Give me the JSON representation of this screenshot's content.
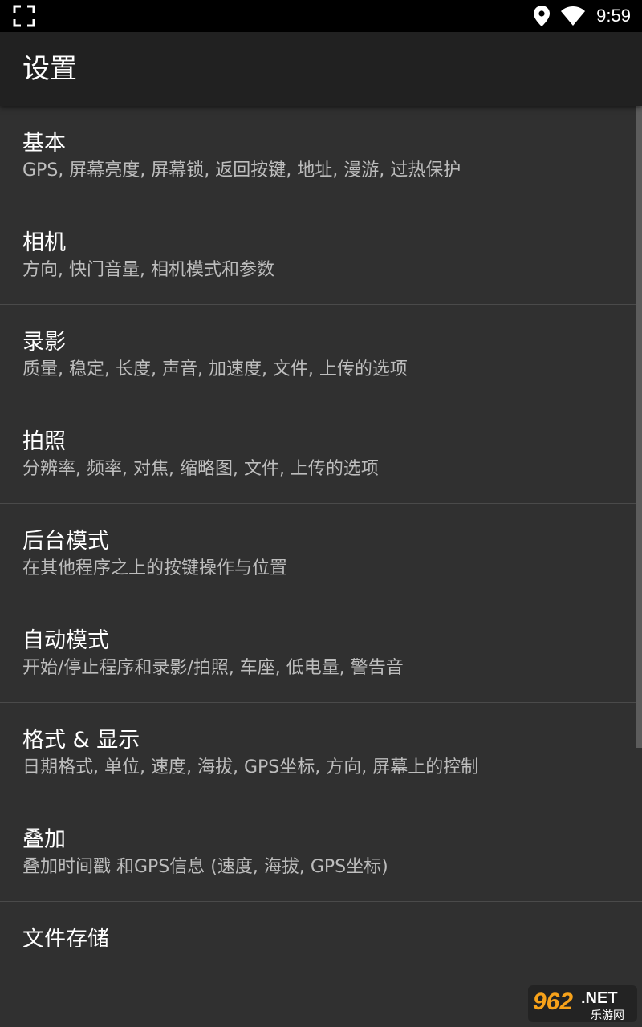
{
  "status_bar": {
    "time": "9:59",
    "icons": [
      "fullscreen-icon",
      "location-icon",
      "wifi-icon"
    ]
  },
  "app_bar": {
    "title": "设置"
  },
  "settings": [
    {
      "title": "基本",
      "summary": "GPS, 屏幕亮度, 屏幕锁, 返回按键, 地址, 漫游, 过热保护"
    },
    {
      "title": "相机",
      "summary": "方向, 快门音量, 相机模式和参数"
    },
    {
      "title": "录影",
      "summary": "质量, 稳定, 长度, 声音, 加速度, 文件, 上传的选项"
    },
    {
      "title": "拍照",
      "summary": "分辨率, 频率, 对焦, 缩略图, 文件, 上传的选项"
    },
    {
      "title": "后台模式",
      "summary": "在其他程序之上的按键操作与位置"
    },
    {
      "title": "自动模式",
      "summary": "开始/停止程序和录影/拍照, 车座, 低电量, 警告音"
    },
    {
      "title": "格式 & 显示",
      "summary": "日期格式, 单位, 速度, 海拔, GPS坐标, 方向, 屏幕上的控制"
    },
    {
      "title": "叠加",
      "summary": "叠加时间戳 和GPS信息 (速度, 海拔, GPS坐标)"
    },
    {
      "title": "文件存储",
      "summary": ""
    }
  ],
  "watermark": {
    "brand": "962",
    "suffix": ".NET",
    "subtitle": "乐游网"
  },
  "colors": {
    "background": "#303030",
    "app_bar": "#212121",
    "status_bar": "#000000",
    "summary_text": "#bdbdbd",
    "divider": "#4a4a4a"
  }
}
